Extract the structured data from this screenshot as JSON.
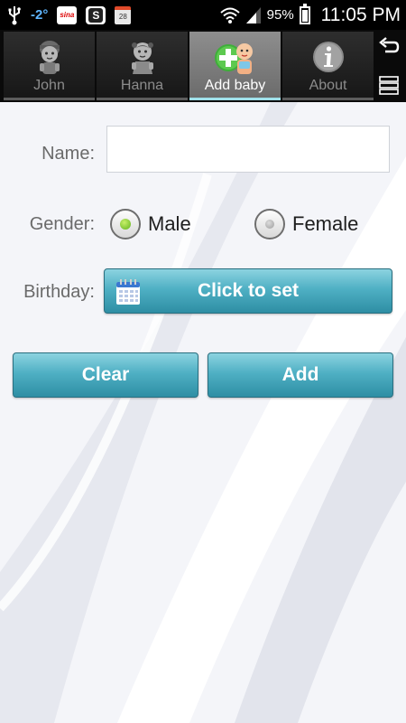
{
  "status_bar": {
    "temperature": "-2°",
    "sina_icon_text": "sina",
    "s_icon_text": "S",
    "calendar_icon_text": "28",
    "battery_percent": "95%",
    "battery_level": 0.95,
    "time": "11:05 PM"
  },
  "tabs": [
    {
      "label": "John",
      "icon": "baby-boy-icon",
      "active": false
    },
    {
      "label": "Hanna",
      "icon": "baby-girl-icon",
      "active": false
    },
    {
      "label": "Add baby",
      "icon": "add-baby-icon",
      "active": true
    },
    {
      "label": "About",
      "icon": "info-icon",
      "active": false
    }
  ],
  "side_actions": [
    {
      "icon": "undo-icon"
    },
    {
      "icon": "menu-icon"
    }
  ],
  "form": {
    "name_label": "Name:",
    "name_value": "",
    "gender_label": "Gender:",
    "gender_options": [
      {
        "label": "Male",
        "checked": true
      },
      {
        "label": "Female",
        "checked": false
      }
    ],
    "birthday_label": "Birthday:",
    "birthday_button": "Click to set",
    "clear_button": "Clear",
    "add_button": "Add"
  },
  "colors": {
    "accent": "#4fb0c4",
    "tab_active_underline": "#9fe0ea",
    "radio_checked": "#5fb21c"
  }
}
